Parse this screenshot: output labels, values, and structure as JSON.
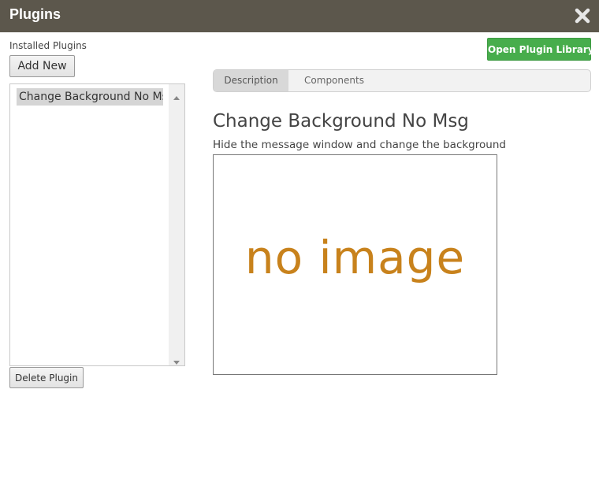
{
  "window": {
    "title": "Plugins"
  },
  "sidebar": {
    "installed_label": "Installed Plugins",
    "add_new_label": "Add New",
    "plugins": [
      "Change Background No Msg"
    ],
    "delete_label": "Delete Plugin"
  },
  "toolbar": {
    "open_library_label": "Open Plugin Library"
  },
  "tabs": [
    {
      "label": "Description",
      "selected": true
    },
    {
      "label": "Components",
      "selected": false
    }
  ],
  "detail": {
    "title": "Change Background No Msg",
    "description": "Hide the message window and change the background",
    "preview_text": "no image"
  },
  "icons": {
    "close": "close-icon",
    "scroll_up": "scroll-up-icon",
    "scroll_down": "scroll-down-icon"
  },
  "colors": {
    "titlebar": "#5c574c",
    "accent": "#47ad4c",
    "noimage": "#c8821c"
  }
}
